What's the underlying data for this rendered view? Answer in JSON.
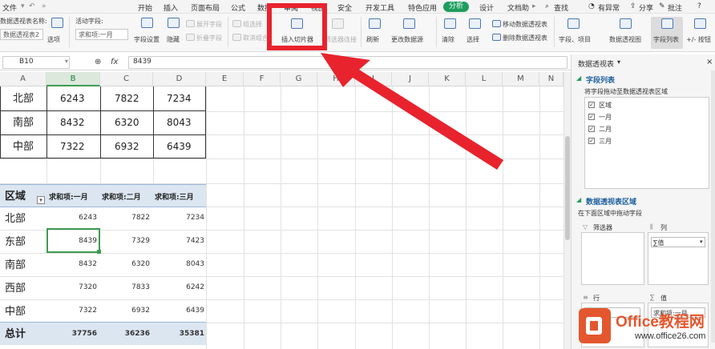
{
  "tabs": [
    "文件",
    "开始",
    "插入",
    "页面布局",
    "公式",
    "数据",
    "审阅",
    "视图",
    "安全",
    "开发工具",
    "特色应用",
    "分析",
    "设计",
    "文档助",
    "查找",
    "有异常",
    "分享",
    "批注",
    "?"
  ],
  "active_tab": "分析",
  "ribbon": {
    "pivot_name_label": "数据透视表名称:",
    "pivot_name_value": "数据透视表2",
    "options": "选项",
    "active_field_label": "活动字段:",
    "active_field_value": "求和项:一月",
    "field_settings": "字段设置",
    "hide": "隐藏",
    "expand_field": "展开字段",
    "collapse_field": "折叠字段",
    "group_selection": "组选择",
    "ungroup": "取消组合",
    "insert_slicer": "插入切片器",
    "filter_connections": "筛选器连接",
    "refresh": "刷新",
    "change_source": "更改数据源",
    "clear": "清除",
    "select": "选择",
    "move_pivot": "移动数据透视表",
    "delete_pivot": "删除数据透视表",
    "fields_items": "字段、项目",
    "pivot_chart": "数据透视图",
    "field_list": "字段列表",
    "plus_minus": "+/- 按钮"
  },
  "formula_bar": {
    "cell": "B10",
    "fx": "fx",
    "value": "8439"
  },
  "columns": [
    "A",
    "B",
    "C",
    "D",
    "E",
    "F",
    "G",
    "H",
    "I",
    "J",
    "K",
    "L",
    "M",
    "N"
  ],
  "source_table": [
    [
      "北部",
      "6243",
      "7822",
      "7234"
    ],
    [
      "南部",
      "8432",
      "6320",
      "8043"
    ],
    [
      "中部",
      "7322",
      "6932",
      "6439"
    ]
  ],
  "pivot": {
    "header": [
      "区域",
      "求和项:一月",
      "求和项:二月",
      "求和项:三月"
    ],
    "rows": [
      [
        "北部",
        "6243",
        "7822",
        "7234"
      ],
      [
        "东部",
        "8439",
        "7329",
        "7423"
      ],
      [
        "南部",
        "8432",
        "6320",
        "8043"
      ],
      [
        "西部",
        "7320",
        "7833",
        "6242"
      ],
      [
        "中部",
        "7322",
        "6932",
        "6439"
      ]
    ],
    "total": [
      "总计",
      "37756",
      "36236",
      "35381"
    ]
  },
  "panel": {
    "title": "数据透视表",
    "field_list_title": "字段列表",
    "drag_hint": "将字段拖动至数据透视表区域",
    "fields": [
      "区域",
      "一月",
      "二月",
      "三月"
    ],
    "areas_title": "数据透视表区域",
    "areas_hint": "在下面区域中拖动字段",
    "filter_label": "筛选器",
    "columns_label": "列",
    "columns_value": "∑值",
    "rows_label": "行",
    "values_label": "值",
    "rows_value": "区域",
    "values_value": "求和项:一月"
  },
  "watermark": {
    "brand": "Office教程网",
    "url": "www.office26.com"
  },
  "colors": {
    "accent": "#1e9e5e",
    "highlight": "#e8232d",
    "pivot_header": "#dce6f1"
  }
}
